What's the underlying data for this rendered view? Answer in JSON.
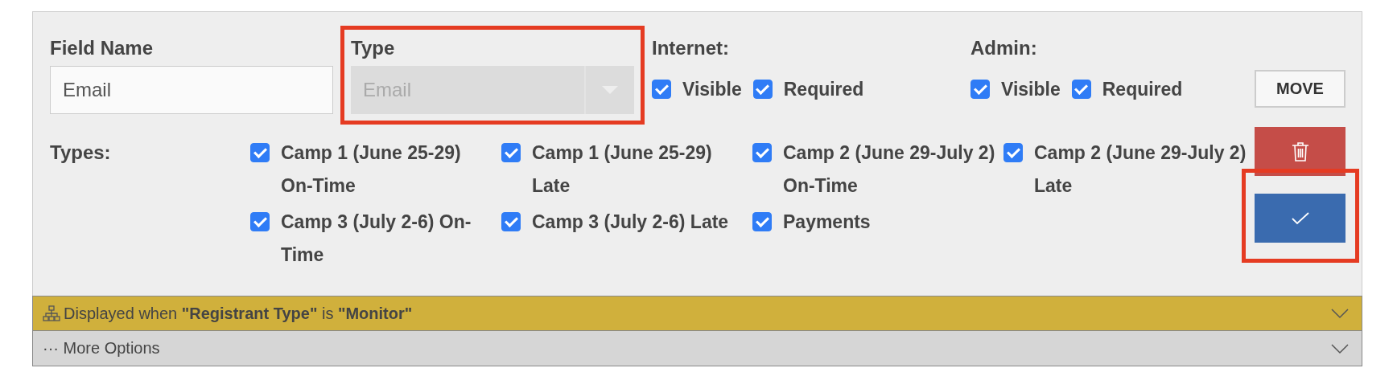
{
  "field_name": {
    "label": "Field Name",
    "value": "Email"
  },
  "type": {
    "label": "Type",
    "value": "Email",
    "disabled": true,
    "highlighted": true
  },
  "internet": {
    "label": "Internet:",
    "options": [
      {
        "label": "Visible",
        "checked": true
      },
      {
        "label": "Required",
        "checked": true
      }
    ]
  },
  "admin": {
    "label": "Admin:",
    "options": [
      {
        "label": "Visible",
        "checked": true
      },
      {
        "label": "Required",
        "checked": true
      }
    ]
  },
  "types": {
    "label": "Types:",
    "options": [
      {
        "label": "Camp 1 (June 25-29) On-Time",
        "checked": true
      },
      {
        "label": "Camp 1 (June 25-29) Late",
        "checked": true
      },
      {
        "label": "Camp 2 (June 29-July 2) On-Time",
        "checked": true
      },
      {
        "label": "Camp 2 (June 29-July 2) Late",
        "checked": true
      },
      {
        "label": "Camp 3 (July 2-6) On-Time",
        "checked": true
      },
      {
        "label": "Camp 3 (July 2-6) Late",
        "checked": true
      },
      {
        "label": "Payments",
        "checked": true
      }
    ]
  },
  "buttons": [
    {
      "kind": "move",
      "label": "MOVE"
    },
    {
      "kind": "delete"
    },
    {
      "kind": "save",
      "highlighted": true
    }
  ],
  "sections": [
    {
      "kind": "condition",
      "text": "Displayed when **\"Registrant Type\"** is **\"Monitor\"**",
      "expanded": false
    },
    {
      "kind": "more",
      "text": "··· More Options",
      "expanded": false
    }
  ]
}
